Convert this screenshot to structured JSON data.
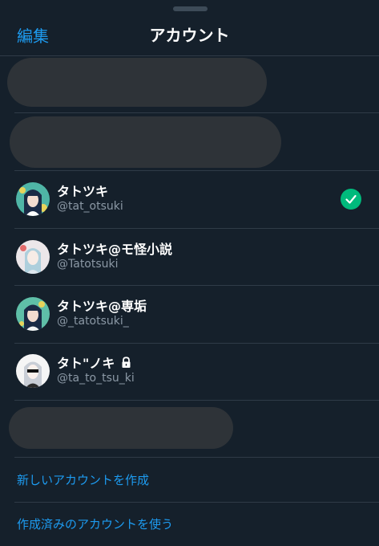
{
  "header": {
    "edit_label": "編集",
    "title": "アカウント"
  },
  "accounts": [
    {
      "name": "タトツキ",
      "handle": "@tat_otsuki",
      "selected": true,
      "locked": false
    },
    {
      "name": "タトツキ@モ怪小説",
      "handle": "@Tatotsuki",
      "selected": false,
      "locked": false
    },
    {
      "name": "タトツキ@専垢",
      "handle": "@_tatotsuki_",
      "selected": false,
      "locked": false
    },
    {
      "name": "タト\"ノキ",
      "handle": "@ta_to_tsu_ki",
      "selected": false,
      "locked": true
    }
  ],
  "actions": {
    "create_new": "新しいアカウントを作成",
    "use_existing": "作成済みのアカウントを使う"
  },
  "colors": {
    "background": "#15202b",
    "accent": "#1d9bf0",
    "check": "#00ba7c",
    "secondary_text": "#8b98a5"
  }
}
